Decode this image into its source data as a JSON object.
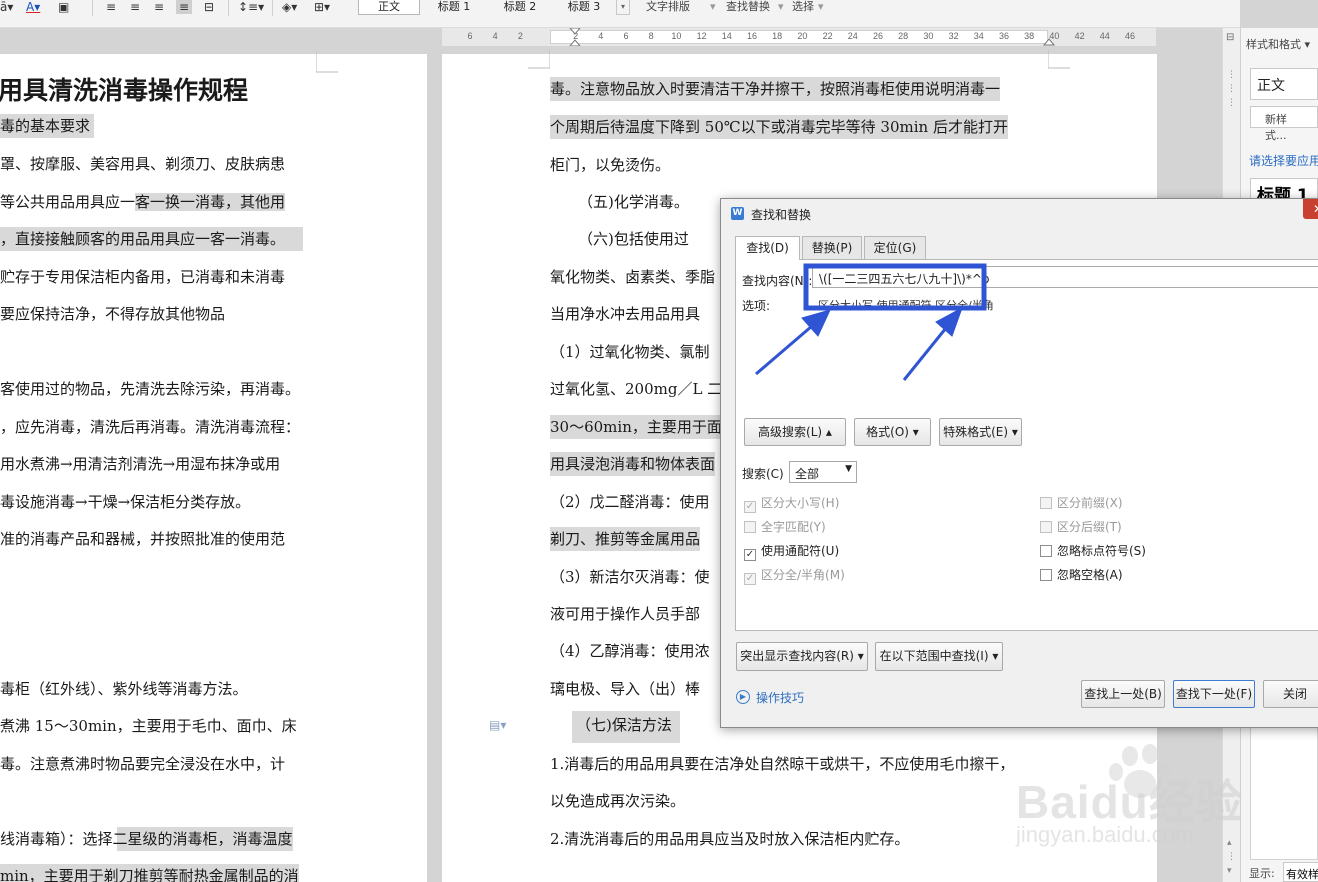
{
  "ribbon": {
    "styles": [
      "正文",
      "标题 1",
      "标题 2",
      "标题 3"
    ],
    "menus": [
      "文字排版",
      "查找替换",
      "选择"
    ]
  },
  "ruler": {
    "numbers": [
      "6",
      "4",
      "2",
      "2",
      "4",
      "6",
      "8",
      "10",
      "12",
      "14",
      "16",
      "18",
      "20",
      "22",
      "24",
      "26",
      "28",
      "30",
      "32",
      "34",
      "36",
      "38",
      "40",
      "42",
      "44",
      "46"
    ]
  },
  "left_page": {
    "lines": [
      "用具清洗消毒操作规程",
      "毒的基本要求",
      "罩、按摩服、美容用具、剃须刀、皮肤病患",
      "等公共用品用具应一客一换一消毒，其他用",
      "，直接接触顾客的用品用具应一客一消毒。",
      "贮存于专用保洁柜内备用，已消毒和未消毒",
      "要应保持洁净，不得存放其他物品",
      "客使用过的物品，先清洗去除污染，再消毒。",
      "，应先消毒，清洗后再消毒。清洗消毒流程：",
      "用水煮沸→用清洁剂清洗→用湿布抹净或用",
      "毒设施消毒→干燥→保洁柜分类存放。",
      "准的消毒产品和器械，并按照批准的使用范",
      "毒柜（红外线）、紫外线等消毒方法。",
      "煮沸 15～30min，主要用于毛巾、面巾、床",
      "毒。注意煮沸时物品要完全浸没在水中，计",
      "线消毒箱）：选择二星级的消毒柜，消毒温度",
      "min，主要用于剃刀推剪等耐热金属制品的消"
    ]
  },
  "right_page": {
    "lines": [
      "毒。注意物品放入时要清洁干净并擦干，按照消毒柜使用说明消毒一",
      "个周期后待温度下降到 50℃以下或消毒完毕等待 30min 后才能打开",
      "柜门，以免烫伤。",
      "（五)化学消毒。",
      "（六)包括使用过",
      "氧化物类、卤素类、季脂",
      "当用净水冲去用品用具",
      "（1）过氧化物类、氯制",
      "过氧化氢、200mg／L 二",
      "30～60min，主要用于面",
      "用具浸泡消毒和物体表面",
      "（2）戊二醛消毒：使用",
      "剃刀、推剪等金属用品",
      "（3）新洁尔灭消毒：使",
      "液可用于操作人员手部",
      "（4）乙醇消毒：使用浓",
      "璃电极、导入（出）棒",
      "（七)保洁方法",
      "1.消毒后的用品用具要在洁净处自然晾干或烘干，不应使用毛巾擦干，",
      "以免造成再次污染。",
      "2.清洗消毒后的用品用具应当及时放入保洁柜内贮存。"
    ]
  },
  "right_panel": {
    "title": "样式和格式 ▾",
    "current_style": "正文",
    "new_style_button": "新样式...",
    "hint": "请选择要应用的格式",
    "heading_preview": "标题 1",
    "show_label": "显示:",
    "show_value": "有效样式"
  },
  "dialog": {
    "title": "查找和替换",
    "tabs": [
      "查找(D)",
      "替换(P)",
      "定位(G)"
    ],
    "find_label": "查找内容(N):",
    "find_value": "\\([一二三四五六七八九十]\\)*^p",
    "options_label": "选项:",
    "options_value": "区分大小写,使用通配符,区分全/半角",
    "advanced_button": "高级搜索(L) ▴",
    "format_button": "格式(O) ▾",
    "special_button": "特殊格式(E) ▾",
    "search_label": "搜索(C)",
    "search_value": "全部",
    "checkboxes_left": [
      {
        "label": "区分大小写(H)",
        "checked": true,
        "disabled": true
      },
      {
        "label": "全字匹配(Y)",
        "checked": false,
        "disabled": true
      },
      {
        "label": "使用通配符(U)",
        "checked": true,
        "disabled": false
      },
      {
        "label": "区分全/半角(M)",
        "checked": true,
        "disabled": true
      }
    ],
    "checkboxes_right": [
      {
        "label": "区分前缀(X)",
        "checked": false,
        "disabled": true
      },
      {
        "label": "区分后缀(T)",
        "checked": false,
        "disabled": true
      },
      {
        "label": "忽略标点符号(S)",
        "checked": false,
        "disabled": false
      },
      {
        "label": "忽略空格(A)",
        "checked": false,
        "disabled": false
      }
    ],
    "highlight_button": "突出显示查找内容(R) ▾",
    "scope_button": "在以下范围中查找(I) ▾",
    "tips_link": "操作技巧",
    "prev_button": "查找上一处(B)",
    "next_button": "查找下一处(F)",
    "close_button": "关闭"
  },
  "watermark": {
    "text": "Baidu经验",
    "sub": "jingyan.baidu.com"
  },
  "colors": {
    "annotation": "#2f55d4",
    "highlight": "#d9d9d9",
    "link": "#2f6fbf"
  }
}
